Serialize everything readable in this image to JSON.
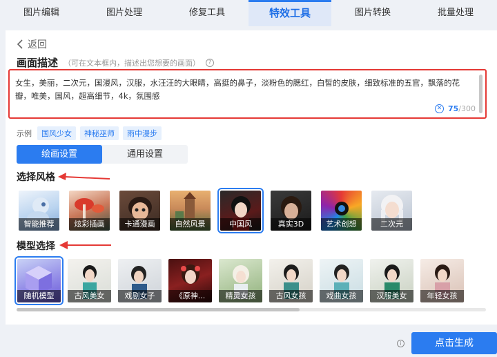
{
  "tabs": [
    {
      "label": "图片编辑"
    },
    {
      "label": "图片处理"
    },
    {
      "label": "修复工具"
    },
    {
      "label": "特效工具"
    },
    {
      "label": "图片转换"
    },
    {
      "label": "批量处理"
    }
  ],
  "active_tab": "特效工具",
  "back_label": "返回",
  "description": {
    "title": "画面描述",
    "hint": "（可在文本框内，描述出您想要的画面）",
    "text": "女生，美丽，二次元，国漫风，汉服，水汪汪的大眼睛，高挺的鼻子，淡粉色的腮红，白皙的皮肤，细致标准的五官，飘落的花瓣，唯美，国风，超高细节，4k，氛围感",
    "count_current": "75",
    "count_max": "/300"
  },
  "examples": {
    "label": "示例",
    "items": [
      "国风少女",
      "神秘巫师",
      "雨中漫步"
    ]
  },
  "subtabs": [
    {
      "label": "绘画设置"
    },
    {
      "label": "通用设置"
    }
  ],
  "style_section": {
    "title": "选择风格",
    "selected": "中国风",
    "items": [
      {
        "label": "智能推荐"
      },
      {
        "label": "炫彩插画"
      },
      {
        "label": "卡通漫画"
      },
      {
        "label": "自然风景"
      },
      {
        "label": "中国风"
      },
      {
        "label": "真实3D"
      },
      {
        "label": "艺术创想"
      },
      {
        "label": "二次元"
      }
    ]
  },
  "model_section": {
    "title": "模型选择",
    "selected": "随机模型",
    "items": [
      {
        "label": "随机模型"
      },
      {
        "label": "古风美女"
      },
      {
        "label": "戏剧女子"
      },
      {
        "label": "《原神..."
      },
      {
        "label": "精灵女孩"
      },
      {
        "label": "古风女孩"
      },
      {
        "label": "戏曲女孩"
      },
      {
        "label": "汉服美女"
      },
      {
        "label": "年轻女孩"
      }
    ]
  },
  "generate_label": "点击生成",
  "colors": {
    "accent": "#2b7cf0",
    "highlight": "#e53935"
  }
}
